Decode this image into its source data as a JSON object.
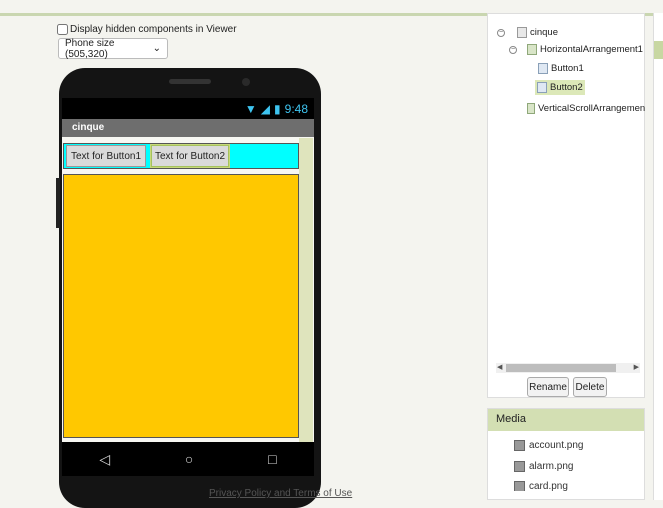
{
  "viewer": {
    "hidden_components_label": "Display hidden components in Viewer",
    "phone_size_value": "Phone size (505,320)",
    "status_time": "9:48",
    "screen_title": "cinque",
    "button1_text": "Text for Button1",
    "button2_text": "Text for Button2",
    "colors": {
      "horizontal_arrangement": "#00ffff",
      "vertical_arrangement": "#ffc800"
    }
  },
  "components_tree": {
    "root": "cinque",
    "horizontal": "HorizontalArrangement1",
    "button1": "Button1",
    "button2": "Button2",
    "vertical": "VerticalScrollArrangemen",
    "selected": "Button2",
    "rename_label": "Rename",
    "delete_label": "Delete"
  },
  "media": {
    "title": "Media",
    "files": [
      "account.png",
      "alarm.png",
      "card.png"
    ]
  },
  "footer": {
    "privacy_link": "Privacy Policy and Terms of Use"
  }
}
